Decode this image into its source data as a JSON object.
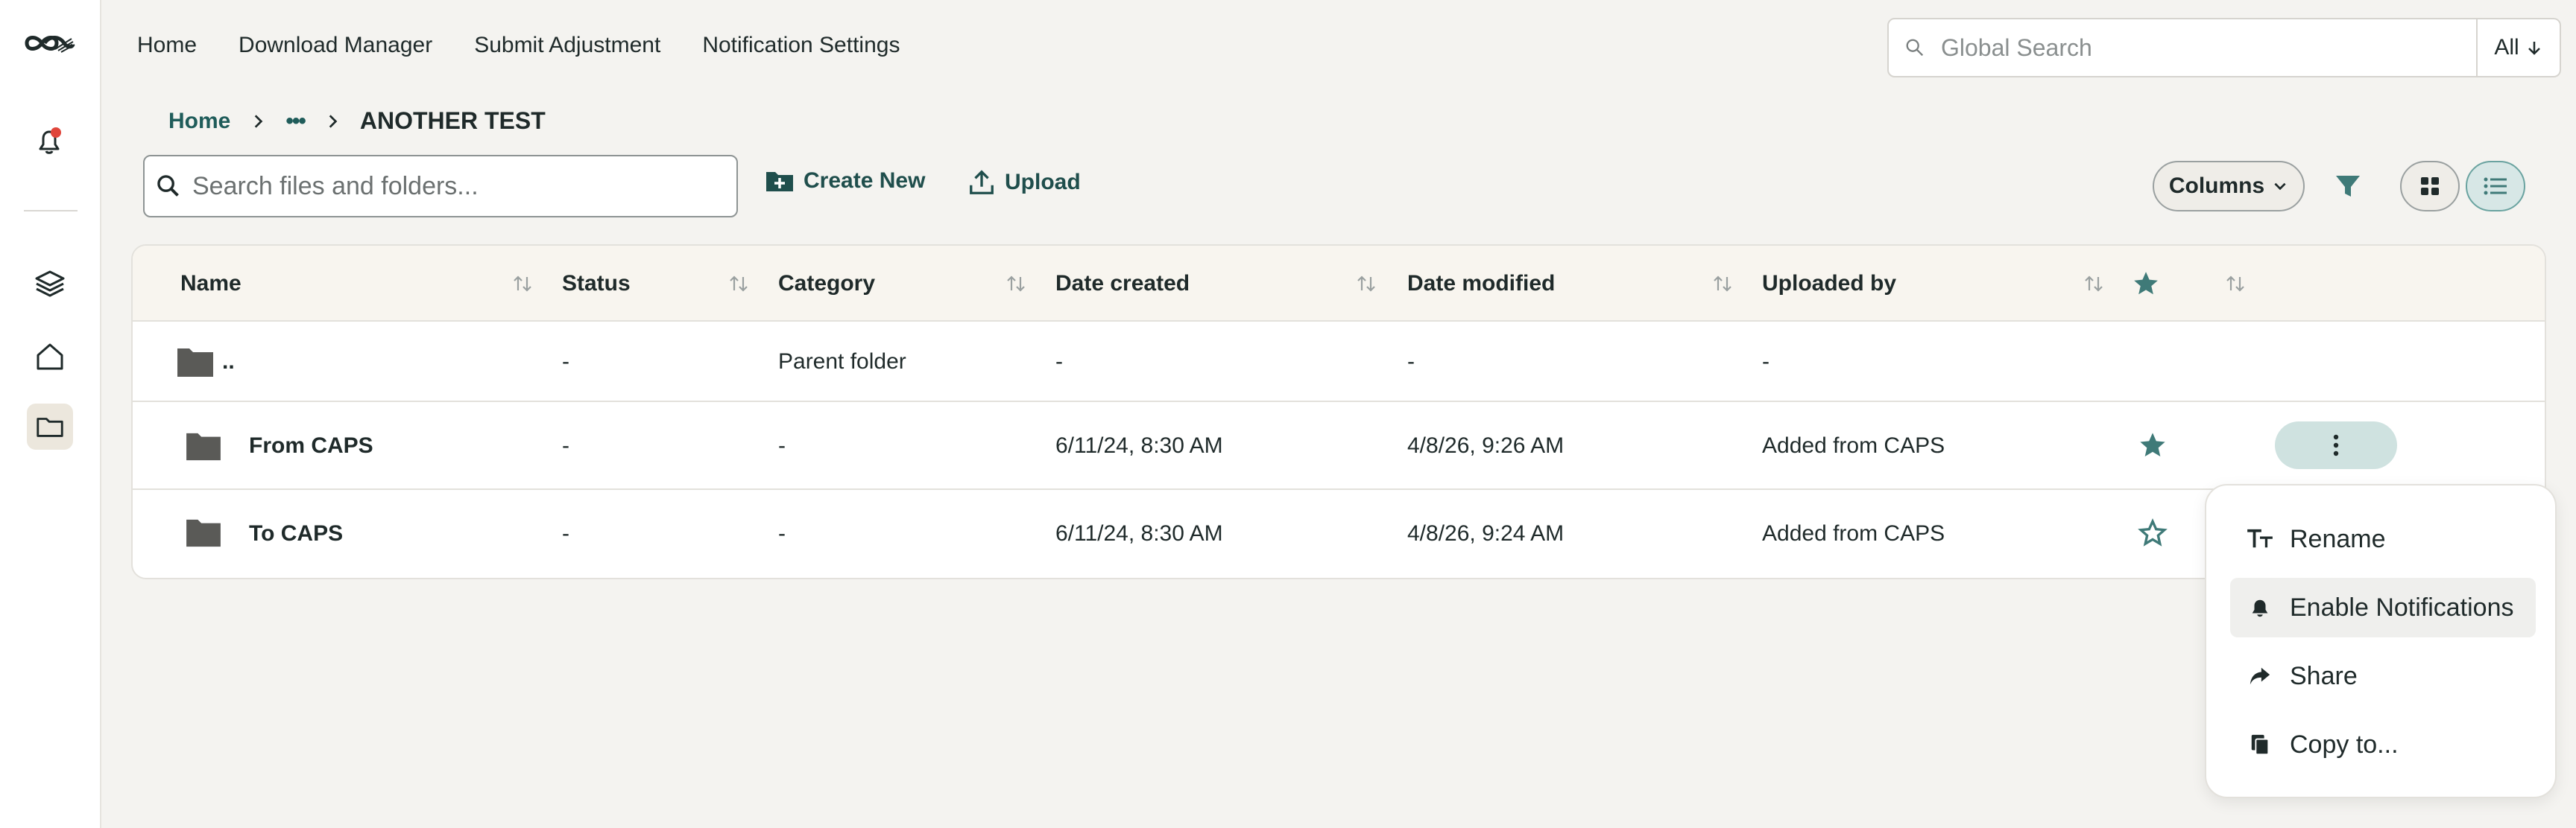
{
  "topnav": {
    "items": [
      "Home",
      "Download Manager",
      "Submit Adjustment",
      "Notification Settings"
    ]
  },
  "global_search": {
    "placeholder": "Global Search",
    "scope": "All"
  },
  "breadcrumb": {
    "home": "Home",
    "ellipsis": "•••",
    "current": "ANOTHER TEST"
  },
  "toolbar": {
    "search_placeholder": "Search files and folders...",
    "create_new": "Create New",
    "upload": "Upload",
    "columns": "Columns"
  },
  "table": {
    "headers": {
      "name": "Name",
      "status": "Status",
      "category": "Category",
      "date_created": "Date created",
      "date_modified": "Date modified",
      "uploaded_by": "Uploaded by"
    },
    "rows": [
      {
        "name": "..",
        "status": "-",
        "category": "Parent folder",
        "date_created": "-",
        "date_modified": "-",
        "uploaded_by": "-",
        "starred": null
      },
      {
        "name": "From CAPS",
        "status": "-",
        "category": "-",
        "date_created": "6/11/24, 8:30 AM",
        "date_modified": "4/8/26, 9:26 AM",
        "uploaded_by": "Added from CAPS",
        "starred": true
      },
      {
        "name": "To CAPS",
        "status": "-",
        "category": "-",
        "date_created": "6/11/24, 8:30 AM",
        "date_modified": "4/8/26, 9:24 AM",
        "uploaded_by": "Added from CAPS",
        "starred": false
      }
    ]
  },
  "context_menu": {
    "items": [
      "Rename",
      "Enable Notifications",
      "Share",
      "Copy to..."
    ]
  },
  "colors": {
    "accent": "#3f7a78",
    "accent_dark": "#1f4e4c",
    "notification_dot": "#e0453a"
  }
}
